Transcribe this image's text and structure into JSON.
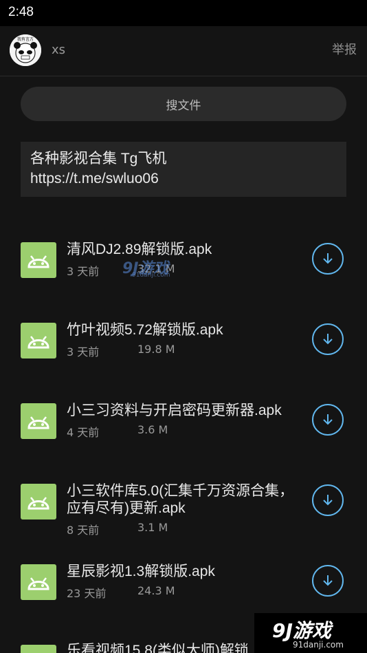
{
  "status_bar": {
    "time": "2:48"
  },
  "header": {
    "username": "xs",
    "report_label": "举报",
    "avatar_text": "我有⾔⽅"
  },
  "search": {
    "label": "搜文件"
  },
  "notice": {
    "line1": "各种影视合集 Tg飞机",
    "line2": "https://t.me/swluo06"
  },
  "files": [
    {
      "name": "清风DJ2.89解锁版.apk",
      "age": "3 天前",
      "size": "32.1 M"
    },
    {
      "name": "竹叶视频5.72解锁版.apk",
      "age": "3 天前",
      "size": "19.8 M"
    },
    {
      "name": "小三习资料与开启密码更新器.apk",
      "age": "4 天前",
      "size": "3.6 M"
    },
    {
      "name": "小三软件库5.0(汇集千万资源合集，应有尽有)更新.apk",
      "age": "8 天前",
      "size": "3.1 M"
    },
    {
      "name": "星辰影视1.3解锁版.apk",
      "age": "23 天前",
      "size": "24.3 M"
    },
    {
      "name": "乐看视频15.8(类似大师)解锁",
      "age": "",
      "size": ""
    }
  ],
  "watermarks": {
    "corner_text": "9J游戏",
    "corner_domain": "91danji.com",
    "mid_text": "9J游戏",
    "mid_domain": "91danji.com"
  },
  "colors": {
    "accent": "#61b7ee",
    "apk_icon": "#9ccf6e",
    "background": "#141414"
  },
  "icons": {
    "file": "android-icon",
    "download": "download-arrow-icon"
  }
}
